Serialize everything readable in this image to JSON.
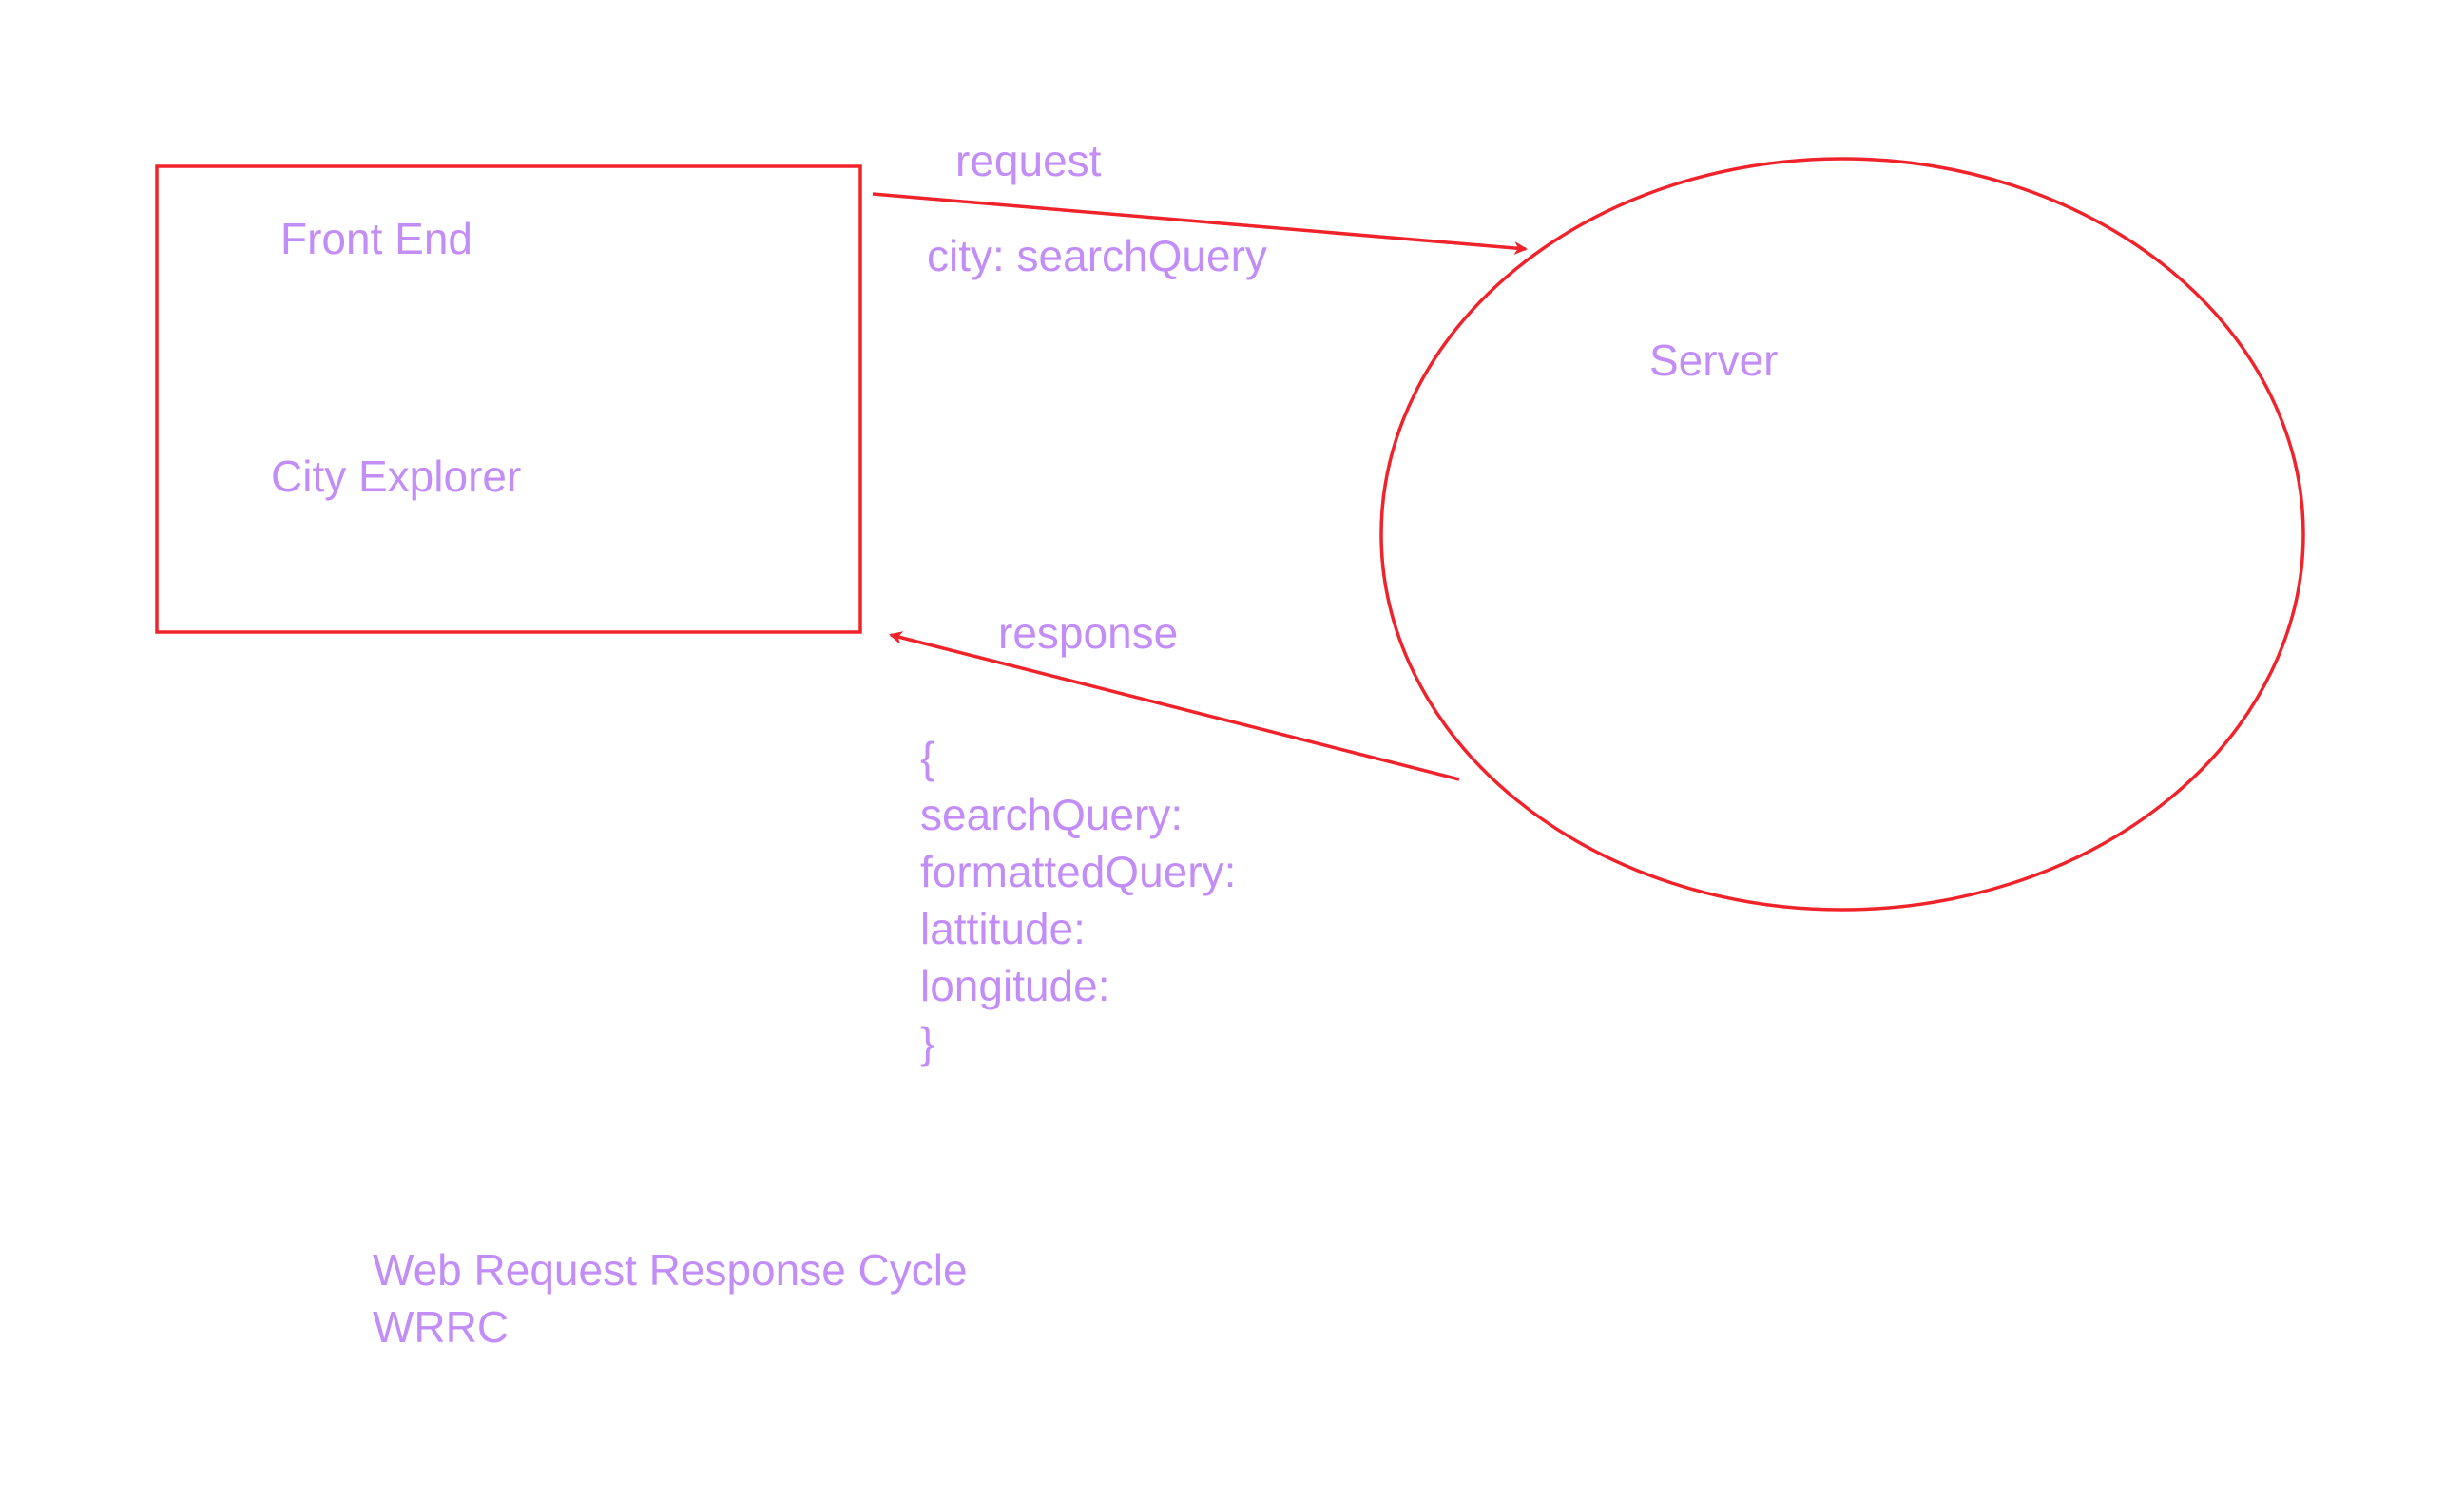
{
  "colors": {
    "shape_stroke": "#f0232b",
    "text": "#c28df7",
    "background": "#ffffff"
  },
  "front_end": {
    "title": "Front End",
    "app_name": "City Explorer"
  },
  "server": {
    "label": "Server"
  },
  "request": {
    "label": "request",
    "param": "city: searchQuery"
  },
  "response": {
    "label": "response",
    "body_lines": [
      "{",
      "searchQuery:",
      "formattedQuery:",
      "lattitude:",
      "longitude:",
      "}"
    ]
  },
  "caption": {
    "line1": "Web Request Response Cycle",
    "line2": "WRRC"
  }
}
